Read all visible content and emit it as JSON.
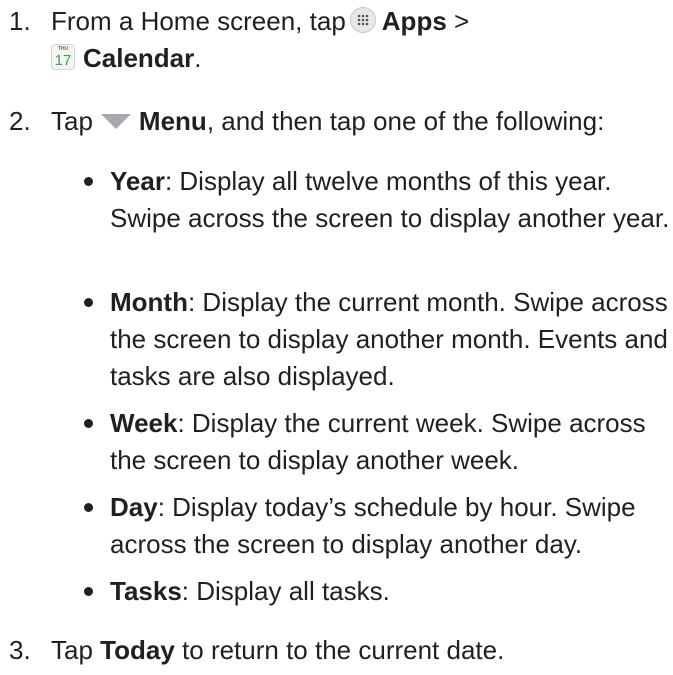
{
  "steps": [
    {
      "number": "1.",
      "prefix": "From a Home screen, tap",
      "apps_label": "Apps",
      "separator": ">",
      "calendar_label": "Calendar",
      "period": ".",
      "calendar_icon_weekday": "THU",
      "calendar_icon_day": "17",
      "icons": [
        "apps-grid-icon",
        "calendar-icon"
      ]
    },
    {
      "number": "2.",
      "prefix": "Tap",
      "menu_label": "Menu",
      "suffix": ", and then tap one of the following:",
      "icons": [
        "menu-triangle-icon"
      ]
    },
    {
      "number": "3.",
      "prefix": "Tap",
      "today_label": "Today",
      "suffix": "to return to the current date."
    }
  ],
  "options": [
    {
      "term": "Year",
      "desc": ": Display all twelve months of this year. Swipe across the screen to display another year."
    },
    {
      "term": "Month",
      "desc": ": Display the current month. Swipe across the screen to display another month. Events and tasks are also displayed."
    },
    {
      "term": "Week",
      "desc": ": Display the current week. Swipe across the screen to display another week."
    },
    {
      "term": "Day",
      "desc": ": Display today’s schedule by hour. Swipe across the screen to display another day."
    },
    {
      "term": "Tasks",
      "desc": ": Display all tasks."
    }
  ],
  "colors": {
    "text": "#231f20",
    "menu_icon": "#a7a9ac",
    "calendar_day": "#3aa548"
  }
}
